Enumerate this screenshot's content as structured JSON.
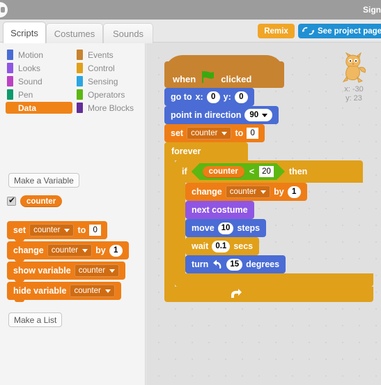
{
  "menubar": {
    "signin_label": "Sign in",
    "logo_name": "scratch-logo"
  },
  "tabs": [
    {
      "label": "Scripts",
      "active": true
    },
    {
      "label": "Costumes",
      "active": false
    },
    {
      "label": "Sounds",
      "active": false
    }
  ],
  "toolbar": {
    "remix_label": "Remix",
    "project_page_label": "See project page"
  },
  "palette": {
    "categories": [
      {
        "label": "Motion",
        "color": "#4a6cd4",
        "selected": false
      },
      {
        "label": "Events",
        "color": "#c88330",
        "selected": false
      },
      {
        "label": "Looks",
        "color": "#8f56e3",
        "selected": false
      },
      {
        "label": "Control",
        "color": "#e0a01a",
        "selected": false
      },
      {
        "label": "Sound",
        "color": "#bb42c3",
        "selected": false
      },
      {
        "label": "Sensing",
        "color": "#2ca5e2",
        "selected": false
      },
      {
        "label": "Pen",
        "color": "#0e9a6c",
        "selected": false
      },
      {
        "label": "Operators",
        "color": "#5cb712",
        "selected": false
      },
      {
        "label": "Data",
        "color": "#ee7d16",
        "selected": true
      },
      {
        "label": "More Blocks",
        "color": "#632d99",
        "selected": false
      }
    ],
    "make_variable_label": "Make a Variable",
    "make_list_label": "Make a List",
    "variable_name": "counter",
    "variable_checked": true,
    "blocks": {
      "set_label": "set",
      "set_to_label": "to",
      "set_value": "0",
      "change_label": "change",
      "change_by_label": "by",
      "change_value": "1",
      "show_label": "show variable",
      "hide_label": "hide variable",
      "dropdown_value": "counter"
    }
  },
  "sprite": {
    "x_label": "x: -30",
    "y_label": "y: 23",
    "icon_name": "scratch-cat"
  },
  "script": {
    "hat": {
      "when_label": "when",
      "clicked_label": "clicked",
      "flag_name": "green-flag-icon"
    },
    "goto": {
      "label": "go to",
      "x_label": "x:",
      "x_value": "0",
      "y_label": "y:",
      "y_value": "0"
    },
    "point": {
      "label": "point in direction",
      "value": "90"
    },
    "set_counter": {
      "label": "set",
      "variable": "counter",
      "to_label": "to",
      "value": "0"
    },
    "forever": {
      "label": "forever"
    },
    "if_block": {
      "if_label": "if",
      "then_label": "then"
    },
    "condition": {
      "left": "counter",
      "operator": "<",
      "right": "20"
    },
    "change_counter": {
      "label": "change",
      "variable": "counter",
      "by_label": "by",
      "value": "1"
    },
    "next_costume": {
      "label": "next costume"
    },
    "move": {
      "label": "move",
      "value": "10",
      "steps_label": "steps"
    },
    "wait": {
      "label": "wait",
      "value": "0.1",
      "secs_label": "secs"
    },
    "turn": {
      "label": "turn",
      "value": "15",
      "degrees_label": "degrees",
      "icon_name": "turn-counterclockwise-icon"
    }
  }
}
